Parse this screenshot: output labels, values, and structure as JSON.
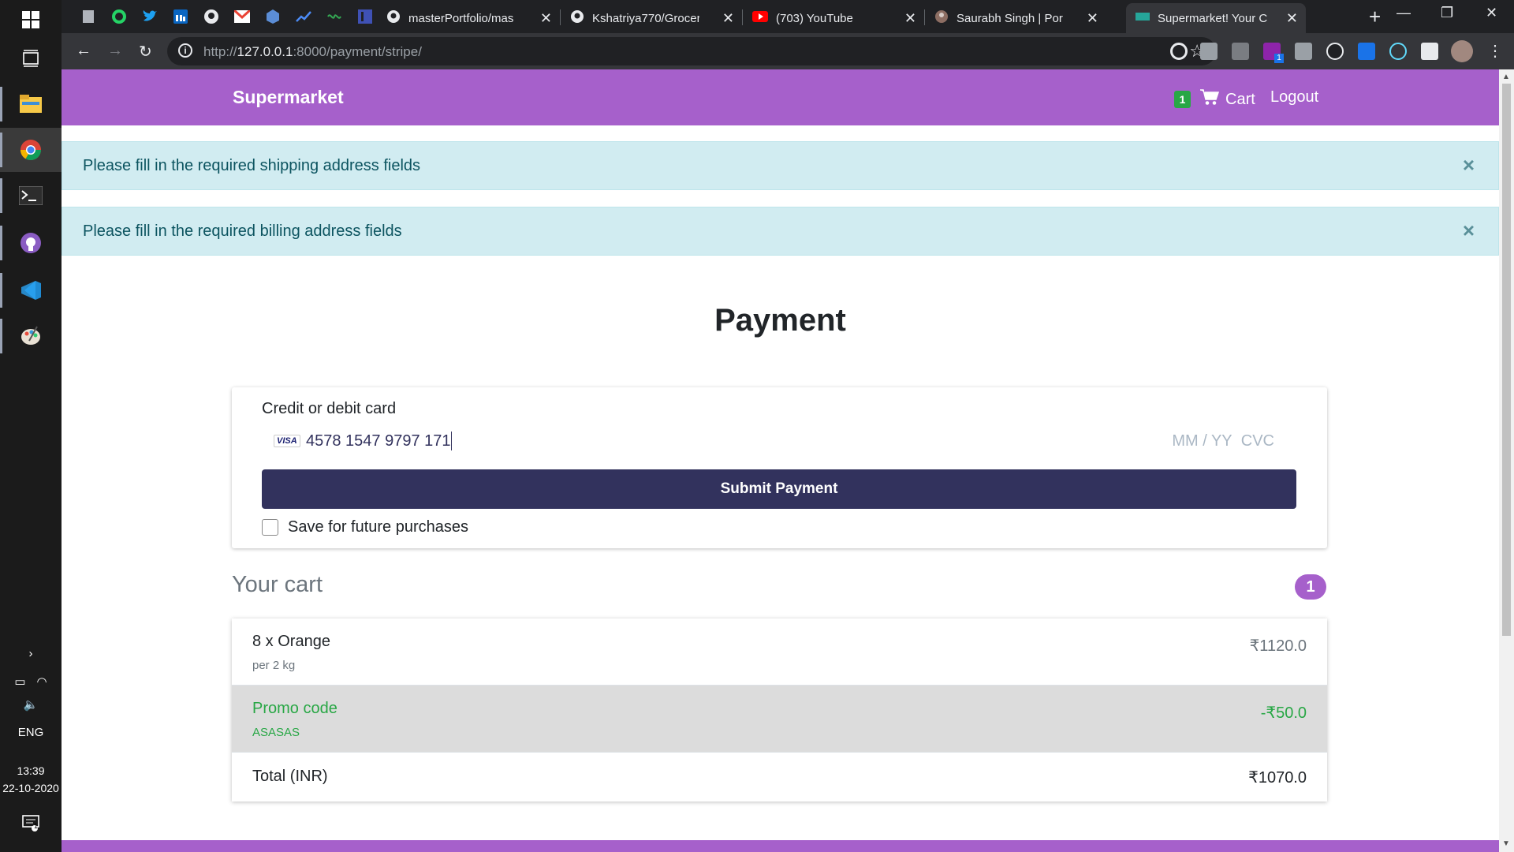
{
  "taskbar": {
    "language": "ENG",
    "time": "13:39",
    "date": "22-10-2020",
    "notifications": "1"
  },
  "browser": {
    "tabs": [
      {
        "title": "masterPortfolio/mas",
        "icon": "github-icon"
      },
      {
        "title": "Kshatriya770/Grocer",
        "icon": "github-icon"
      },
      {
        "title": "(703) YouTube",
        "icon": "youtube-icon"
      },
      {
        "title": "Saurabh Singh | Por",
        "icon": "avatar-icon"
      },
      {
        "title": "Supermarket! Your C",
        "icon": "page-icon",
        "active": true
      }
    ],
    "url_host": "127.0.0.1",
    "url_prefix": "http://",
    "url_rest": ":8000/payment/stripe/",
    "extension_badge": "1"
  },
  "navbar": {
    "brand": "Supermarket",
    "cart_count": "1",
    "cart_label": "Cart",
    "logout_label": "Logout",
    "color": "#a660cb"
  },
  "alerts": [
    {
      "message": "Please fill in the required shipping address fields",
      "close": "×"
    },
    {
      "message": "Please fill in the required billing address fields",
      "close": "×"
    }
  ],
  "payment": {
    "title": "Payment",
    "card_label": "Credit or debit card",
    "card_brand": "VISA",
    "card_number": "4578 1547 9797 171",
    "expiry_placeholder": "MM / YY",
    "cvc_placeholder": "CVC",
    "submit_label": "Submit Payment",
    "save_label": "Save for future purchases"
  },
  "cart": {
    "heading": "Your cart",
    "count": "1",
    "items": [
      {
        "name": "8 x Orange",
        "sub": "per 2 kg",
        "price": "₹1120.0"
      }
    ],
    "promo": {
      "label": "Promo code",
      "code": "ASASAS",
      "amount": "-₹50.0"
    },
    "total": {
      "label": "Total (INR)",
      "amount": "₹1070.0"
    }
  }
}
